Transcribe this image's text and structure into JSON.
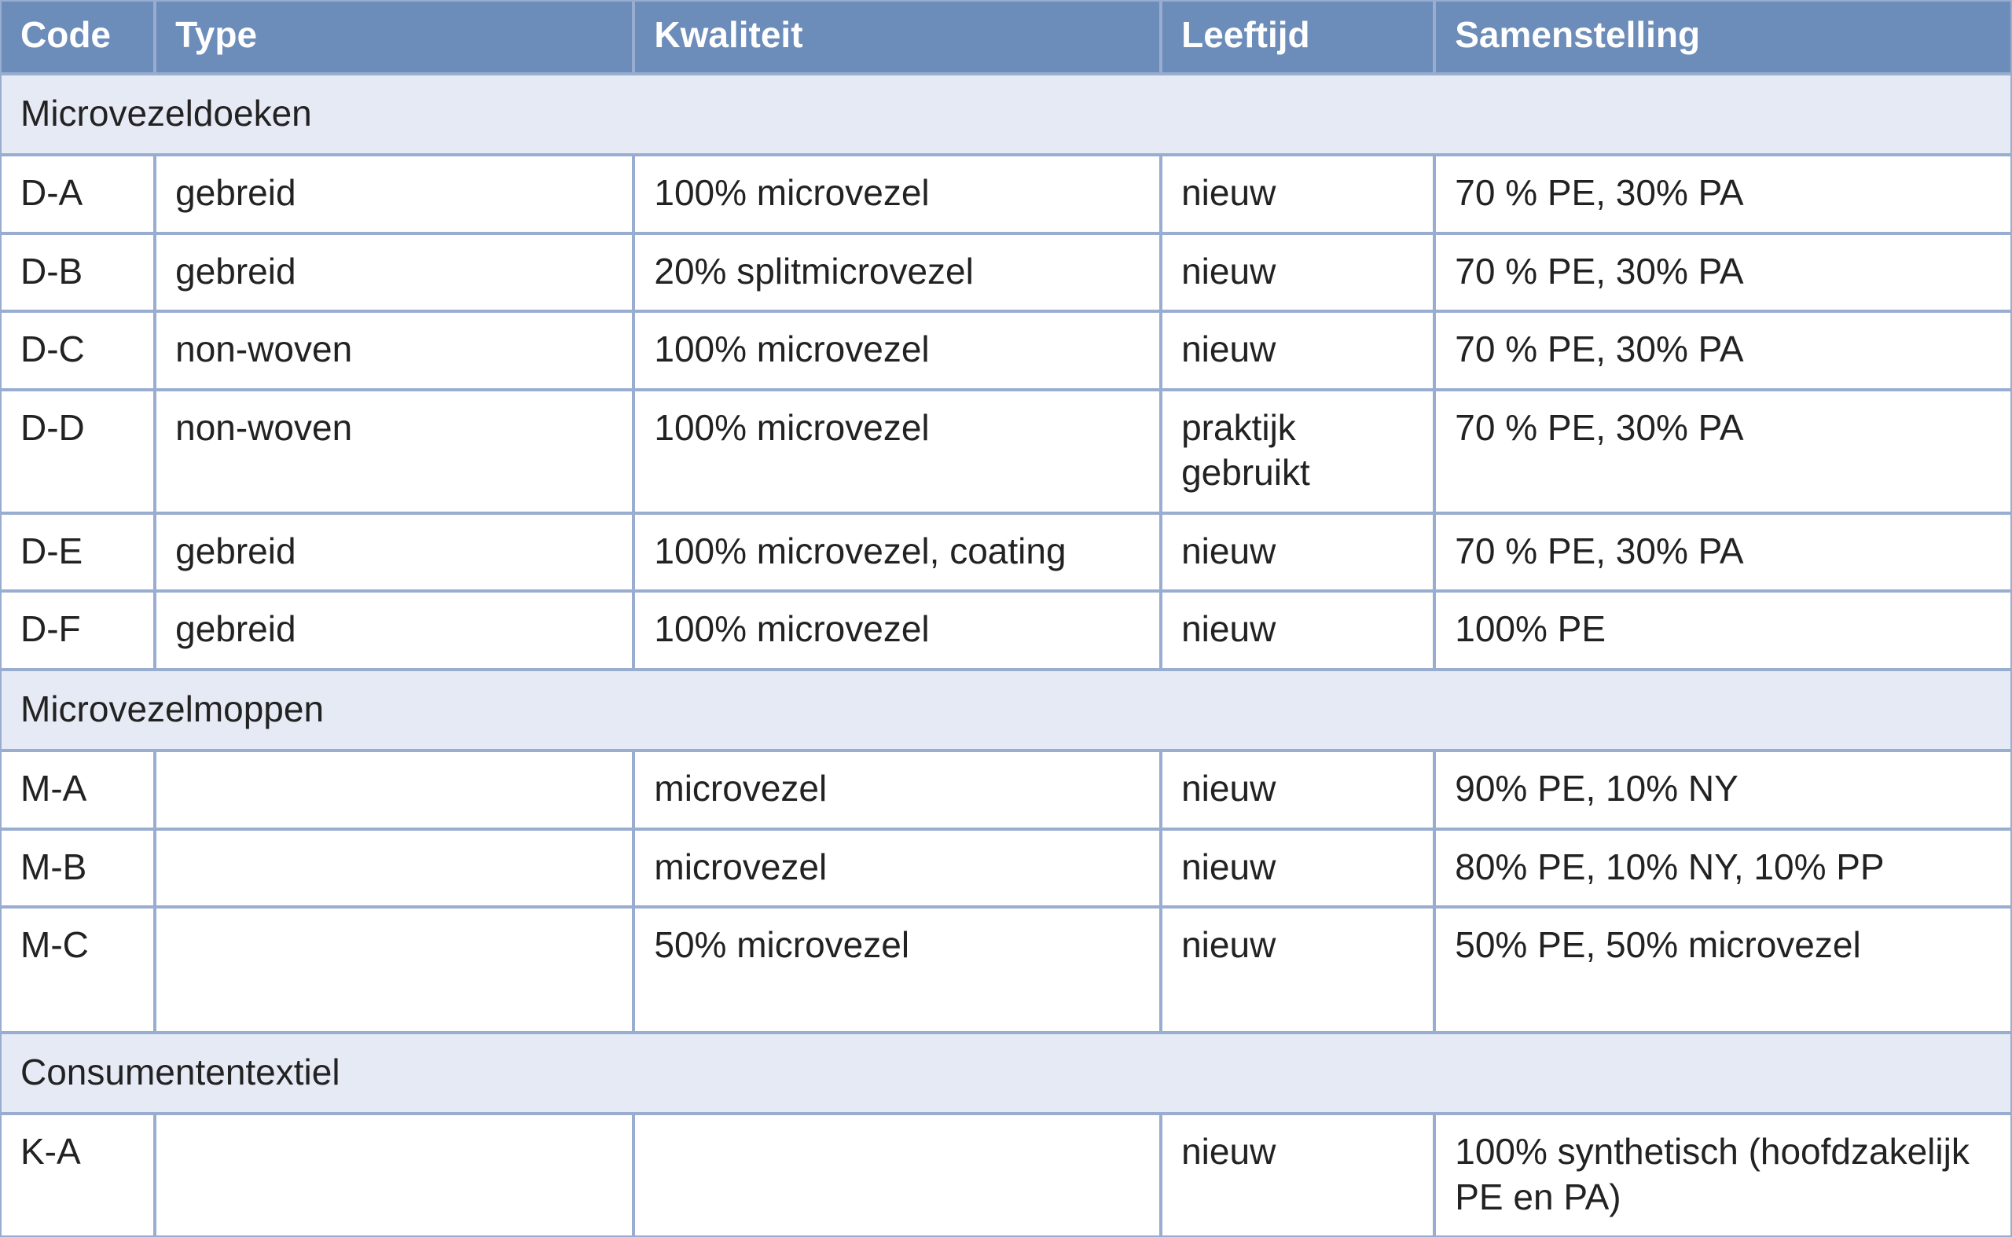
{
  "headers": {
    "code": "Code",
    "type": "Type",
    "kwaliteit": "Kwaliteit",
    "leeftijd": "Leeftijd",
    "samenstelling": "Samenstelling"
  },
  "sections": {
    "s1": "Microvezeldoeken",
    "s2": "Microvezelmoppen",
    "s3": "Consumententextiel"
  },
  "rows": {
    "r1": {
      "code": "D-A",
      "type": "gebreid",
      "kwaliteit": "100% microvezel",
      "leeftijd": "nieuw",
      "samenstelling": "70 % PE, 30% PA"
    },
    "r2": {
      "code": "D-B",
      "type": "gebreid",
      "kwaliteit": "20% splitmicrovezel",
      "leeftijd": "nieuw",
      "samenstelling": "70 % PE, 30% PA"
    },
    "r3": {
      "code": "D-C",
      "type": "non-woven",
      "kwaliteit": "100% microvezel",
      "leeftijd": "nieuw",
      "samenstelling": "70 % PE, 30% PA"
    },
    "r4": {
      "code": "D-D",
      "type": "non-woven",
      "kwaliteit": "100% microvezel",
      "leeftijd": "praktijk gebruikt",
      "samenstelling": "70 % PE, 30% PA"
    },
    "r5": {
      "code": "D-E",
      "type": "gebreid",
      "kwaliteit": "100% microvezel, coating",
      "leeftijd": "nieuw",
      "samenstelling": "70 % PE, 30% PA"
    },
    "r6": {
      "code": "D-F",
      "type": "gebreid",
      "kwaliteit": "100% microvezel",
      "leeftijd": "nieuw",
      "samenstelling": "100% PE"
    },
    "r7": {
      "code": "M-A",
      "type": "",
      "kwaliteit": "microvezel",
      "leeftijd": "nieuw",
      "samenstelling": "90% PE, 10% NY"
    },
    "r8": {
      "code": "M-B",
      "type": "",
      "kwaliteit": "microvezel",
      "leeftijd": "nieuw",
      "samenstelling": "80% PE, 10% NY, 10% PP"
    },
    "r9": {
      "code": "M-C",
      "type": "",
      "kwaliteit": "50% microvezel",
      "leeftijd": "nieuw",
      "samenstelling": "50% PE, 50% microvezel"
    },
    "r10": {
      "code": "K-A",
      "type": "",
      "kwaliteit": "",
      "leeftijd": "nieuw",
      "samenstelling": "100% synthetisch (hoofdzakelijk PE en PA)"
    }
  }
}
